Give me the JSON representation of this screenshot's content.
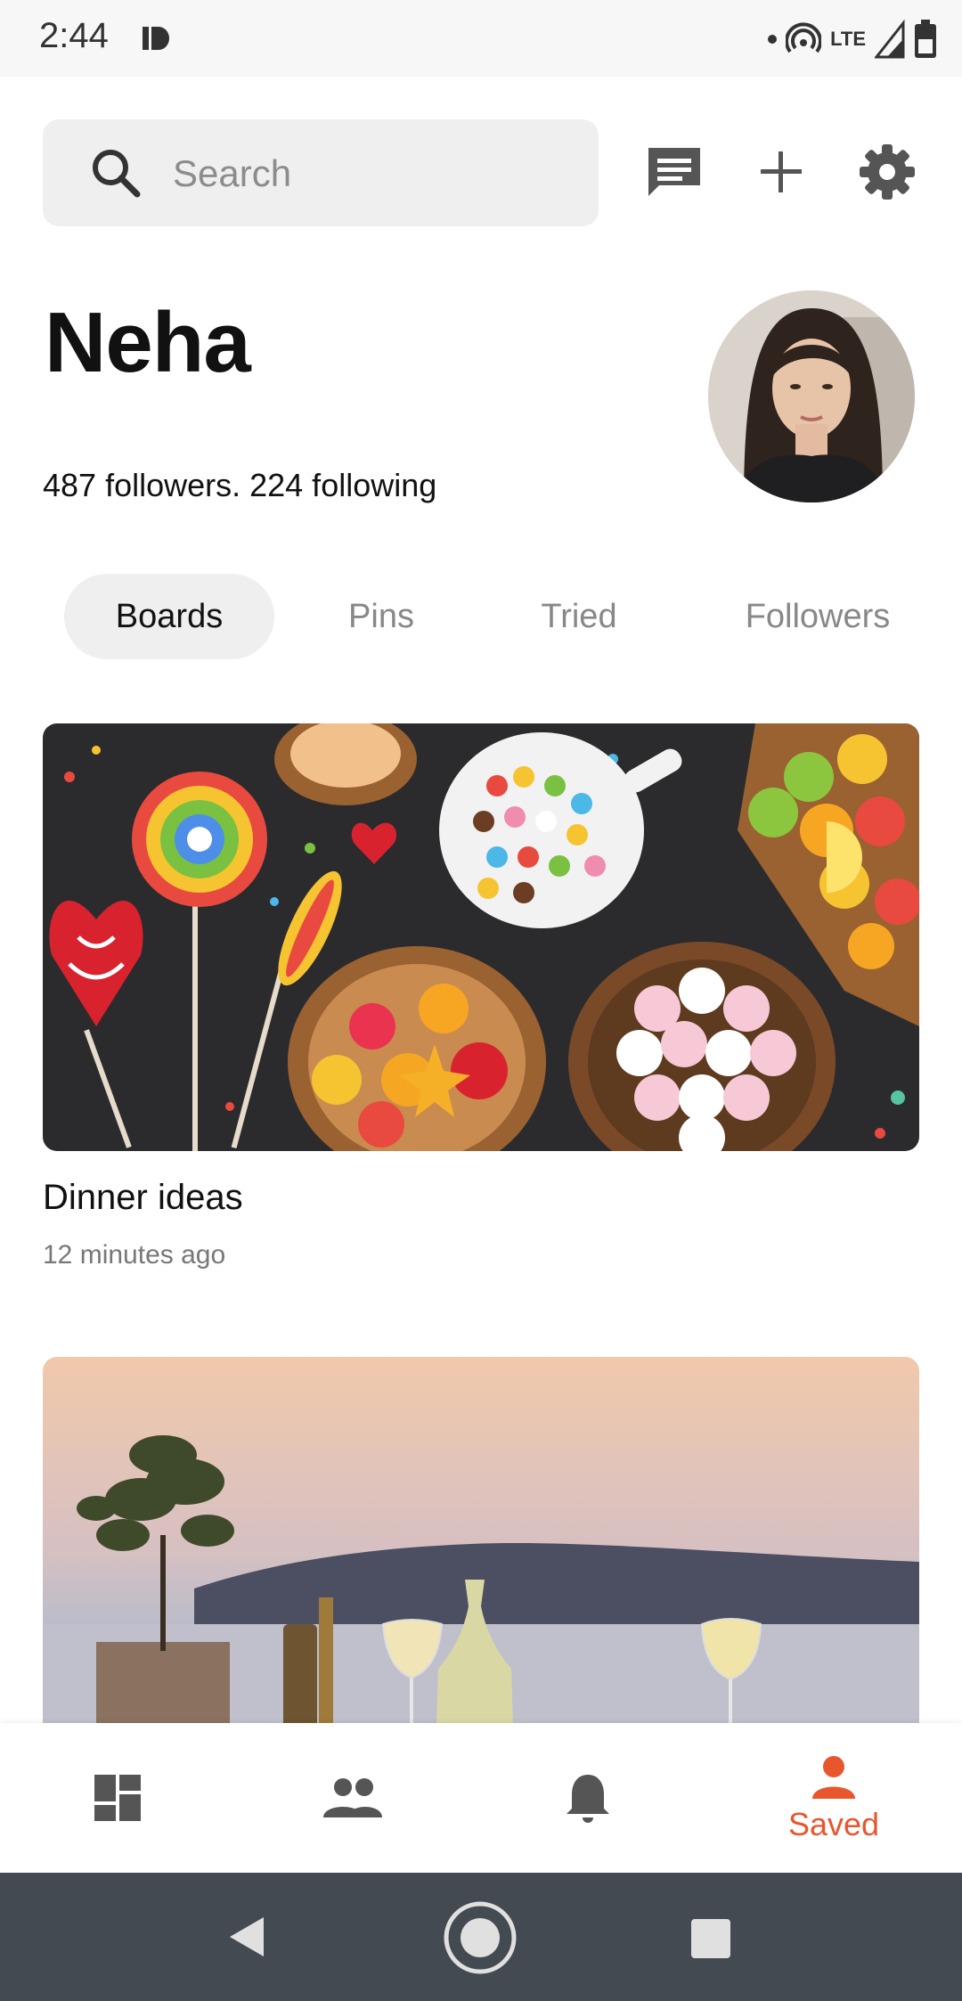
{
  "status_bar": {
    "time": "2:44",
    "network": "LTE"
  },
  "header": {
    "search": {
      "placeholder": "Search",
      "value": ""
    },
    "icons": [
      "message-icon",
      "plus-icon",
      "gear-icon"
    ]
  },
  "profile": {
    "name": "Neha",
    "stats": "487 followers. 224 following"
  },
  "tabs": [
    {
      "label": "Boards",
      "active": true
    },
    {
      "label": "Pins",
      "active": false
    },
    {
      "label": "Tried",
      "active": false
    },
    {
      "label": "Followers",
      "active": false
    }
  ],
  "boards": [
    {
      "title": "Dinner ideas",
      "time": "12 minutes ago"
    },
    {
      "title": "",
      "time": ""
    }
  ],
  "bottom_nav": {
    "items": [
      {
        "icon": "dashboard-icon",
        "label": ""
      },
      {
        "icon": "people-icon",
        "label": ""
      },
      {
        "icon": "bell-icon",
        "label": ""
      },
      {
        "icon": "person-icon",
        "label": "Saved",
        "active": true
      }
    ]
  },
  "colors": {
    "accent": "#e8562e",
    "search_bg": "#efefef",
    "system_nav": "#444a52"
  }
}
